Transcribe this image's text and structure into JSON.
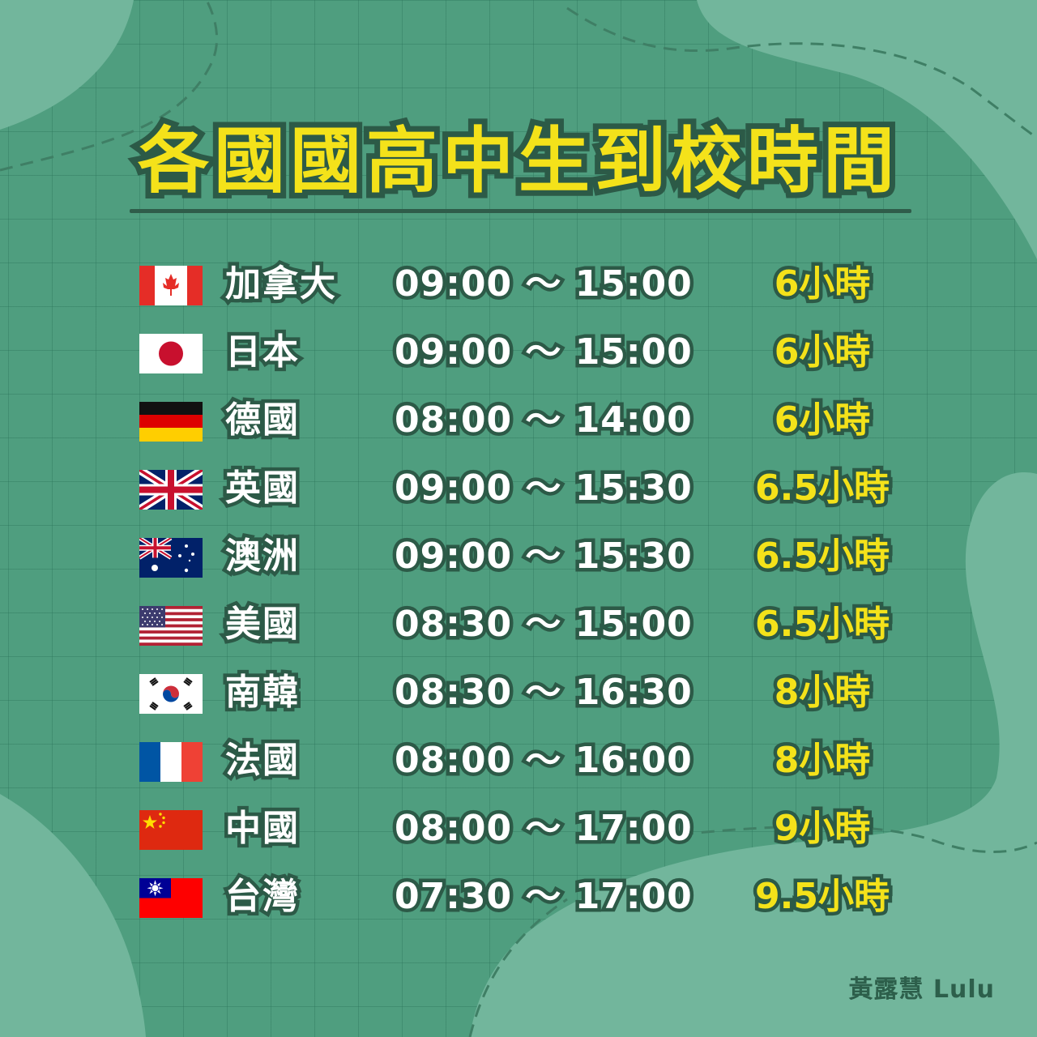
{
  "title": "各國國高中生到校時間",
  "credit": "黃露慧 Lulu",
  "colors": {
    "background": "#4f9e7f",
    "blob": "#72b69c",
    "title": "#f4e21a",
    "outline": "#2c5a47"
  },
  "rows": [
    {
      "flag": "canada-flag-icon",
      "country": "加拿大",
      "time": "09:00 ～ 15:00",
      "hours": "6小時"
    },
    {
      "flag": "japan-flag-icon",
      "country": "日本",
      "time": "09:00 ～ 15:00",
      "hours": "6小時"
    },
    {
      "flag": "germany-flag-icon",
      "country": "德國",
      "time": "08:00 ～ 14:00",
      "hours": "6小時"
    },
    {
      "flag": "uk-flag-icon",
      "country": "英國",
      "time": "09:00 ～ 15:30",
      "hours": "6.5小時"
    },
    {
      "flag": "australia-flag-icon",
      "country": "澳洲",
      "time": "09:00 ～ 15:30",
      "hours": "6.5小時"
    },
    {
      "flag": "usa-flag-icon",
      "country": "美國",
      "time": "08:30 ～ 15:00",
      "hours": "6.5小時"
    },
    {
      "flag": "korea-flag-icon",
      "country": "南韓",
      "time": "08:30 ～ 16:30",
      "hours": "8小時"
    },
    {
      "flag": "france-flag-icon",
      "country": "法國",
      "time": "08:00 ～ 16:00",
      "hours": "8小時"
    },
    {
      "flag": "china-flag-icon",
      "country": "中國",
      "time": "08:00 ～ 17:00",
      "hours": "9小時"
    },
    {
      "flag": "taiwan-flag-icon",
      "country": "台灣",
      "time": "07:30 ～ 17:00",
      "hours": "9.5小時"
    }
  ]
}
